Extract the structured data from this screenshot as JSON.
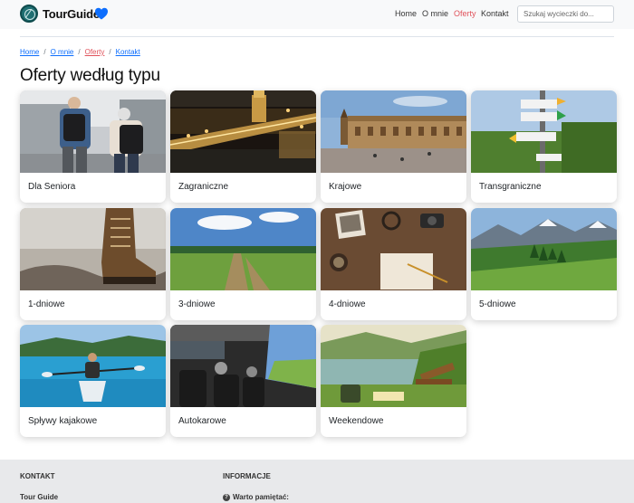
{
  "navbar": {
    "brand": "TourGuide",
    "links": [
      "Home",
      "O mnie",
      "Oferty",
      "Kontakt"
    ],
    "search_placeholder": "Szukaj wycieczki do..."
  },
  "breadcrumb": [
    "Home",
    "O mnie",
    "Oferty",
    "Kontakt"
  ],
  "page_title": "Oferty według typu",
  "cards": [
    {
      "label": "Dla Seniora"
    },
    {
      "label": "Zagraniczne"
    },
    {
      "label": "Krajowe"
    },
    {
      "label": "Transgraniczne"
    },
    {
      "label": "1-dniowe"
    },
    {
      "label": "3-dniowe"
    },
    {
      "label": "4-dniowe"
    },
    {
      "label": "5-dniowe"
    },
    {
      "label": "Spływy kajakowe"
    },
    {
      "label": "Autokarowe"
    },
    {
      "label": "Weekendowe"
    }
  ],
  "footer": {
    "kontakt_heading": "KONTAKT",
    "kontakt_name": "Tour Guide",
    "info_heading": "INFORMACJE",
    "info_note": "Warto pamiętać:"
  },
  "colors": {
    "accent_link": "#0d6efd",
    "active_link": "#e0525b",
    "heart": "#0d6efd",
    "footer_bg": "#e8e9eb"
  },
  "icons": [
    "globe-logo-icon",
    "heart-icon",
    "question-circle-icon"
  ]
}
